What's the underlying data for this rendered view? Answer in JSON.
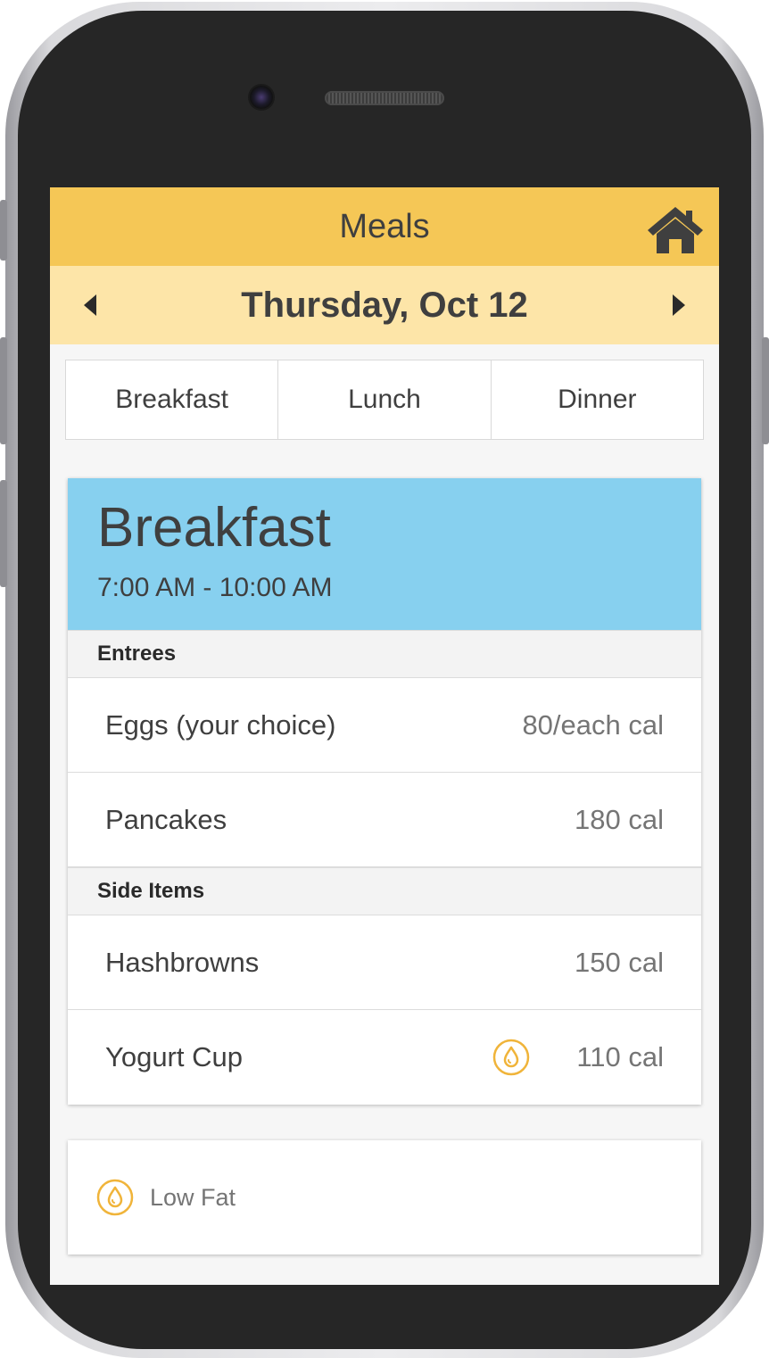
{
  "header": {
    "title": "Meals",
    "home_icon": "home-icon"
  },
  "date_bar": {
    "date": "Thursday, Oct 12",
    "prev_icon": "caret-left-icon",
    "next_icon": "caret-right-icon"
  },
  "tabs": [
    {
      "label": "Breakfast"
    },
    {
      "label": "Lunch"
    },
    {
      "label": "Dinner"
    }
  ],
  "meal": {
    "name": "Breakfast",
    "time": "7:00 AM - 10:00 AM",
    "sections": [
      {
        "title": "Entrees",
        "items": [
          {
            "name": "Eggs (your choice)",
            "calories": "80/each cal",
            "low_fat": false
          },
          {
            "name": "Pancakes",
            "calories": "180 cal",
            "low_fat": false
          }
        ]
      },
      {
        "title": "Side Items",
        "items": [
          {
            "name": "Hashbrowns",
            "calories": "150 cal",
            "low_fat": false
          },
          {
            "name": "Yogurt Cup",
            "calories": "110 cal",
            "low_fat": true
          }
        ]
      }
    ]
  },
  "legend": {
    "label": "Low Fat",
    "icon": "low-fat-drop-icon"
  },
  "colors": {
    "header_bg": "#f5c756",
    "date_bar_bg": "#fde5a8",
    "meal_header_bg": "#87d0ef",
    "low_fat_icon": "#f0b43a"
  }
}
